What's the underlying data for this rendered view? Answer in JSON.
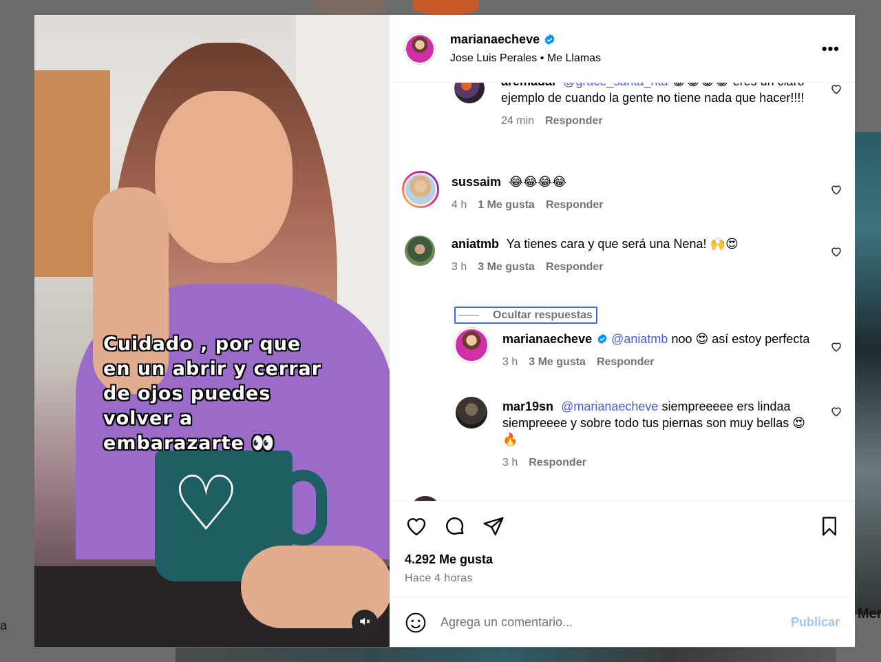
{
  "background": {
    "left_partial_text": "a",
    "right_partial_text": "Mer"
  },
  "post": {
    "overlay_text": "Cuidado , por que en un abrir y cerrar de ojos puedes volver a embarazarte 👀",
    "mute_icon": "speaker-muted-icon"
  },
  "header": {
    "username": "marianaecheve",
    "verified": true,
    "audio_artist": "Jose Luis Perales",
    "separator": "•",
    "audio_song": "Me Llamas",
    "more_icon": "more-horizontal-icon",
    "more_label": "•••"
  },
  "comments": [
    {
      "username": "aremadai",
      "mention": "@grace_santa_rita",
      "text": "😂😂😂😂 eres un claro ejemplo de cuando la gente no tiene nada que hacer!!!!",
      "time": "24 min",
      "reply_label": "Responder"
    },
    {
      "username": "sussaim",
      "text": "😂😂😂😂",
      "time": "4 h",
      "likes": "1 Me gusta",
      "reply_label": "Responder"
    },
    {
      "username": "aniatmb",
      "text": "Ya tienes cara y que será una Nena! 🙌😍",
      "time": "3 h",
      "likes": "3 Me gusta",
      "reply_label": "Responder",
      "hide_replies_label": "Ocultar respuestas",
      "replies": [
        {
          "username": "marianaecheve",
          "verified": true,
          "mention": "@aniatmb",
          "text": "noo 😍 así estoy perfecta",
          "time": "3 h",
          "likes": "3 Me gusta",
          "reply_label": "Responder"
        },
        {
          "username": "mar19sn",
          "mention": "@marianaecheve",
          "text": "siempreeeee ers lindaa siempreeee y sobre todo tus piernas son muy bellas 😍🔥",
          "time": "3 h",
          "reply_label": "Responder"
        }
      ]
    }
  ],
  "actions": {
    "like_icon": "heart-outline-icon",
    "comment_icon": "comment-bubble-icon",
    "share_icon": "paper-plane-icon",
    "save_icon": "bookmark-icon",
    "likes_count": "4.292 Me gusta",
    "posted_ago": "Hace 4 horas"
  },
  "composer": {
    "emoji_icon": "smiley-icon",
    "placeholder": "Agrega un comentario...",
    "publish_label": "Publicar"
  },
  "colors": {
    "verified_blue": "#0095f6",
    "mention": "#4f5bd5",
    "publish_disabled": "#a4c4f4",
    "secondary_text": "#737373"
  }
}
